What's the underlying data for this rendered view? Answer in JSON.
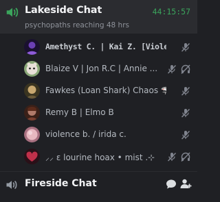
{
  "channel": {
    "name": "Lakeside Chat",
    "status": "psychopaths reaching 48 hrs",
    "timer": "44:15:57",
    "icon": "speaker-icon",
    "accent": "#3ba55c"
  },
  "members": [
    {
      "name": "Amethyst C. | Kai Z. [Violet]",
      "avatar_colors": [
        "#6b3fb5",
        "#1a1030"
      ],
      "icons": [
        "mic-muted-icon"
      ]
    },
    {
      "name": "Blaize V | Jon R.C | Annie ...",
      "avatar_colors": [
        "#d8d0c8",
        "#8aa878"
      ],
      "icons": [
        "mic-muted-icon",
        "headset-deafened-icon"
      ]
    },
    {
      "name": "Fawkes (Loan Shark) Chaos 🦈",
      "avatar_colors": [
        "#c8a870",
        "#3a3420"
      ],
      "icons": [
        "mic-muted-icon"
      ]
    },
    {
      "name": "Remy B | Elmo B",
      "avatar_colors": [
        "#b07a6a",
        "#3a2018"
      ],
      "icons": [
        "mic-muted-icon"
      ]
    },
    {
      "name": "violence b. / irida c.",
      "avatar_colors": [
        "#e8b8c0",
        "#a87080"
      ],
      "icons": [
        "mic-muted-icon"
      ]
    },
    {
      "name": "⸝⸝ ɛ lourine hoax • mist .⊹",
      "avatar_colors": [
        "#c0304a",
        "#2a1018"
      ],
      "icons": [
        "mic-muted-icon",
        "headset-deafened-icon"
      ]
    }
  ],
  "fireside": {
    "name": "Fireside Chat",
    "icon": "speaker-icon",
    "actions": [
      "chat-bubble-icon",
      "add-member-icon"
    ]
  }
}
